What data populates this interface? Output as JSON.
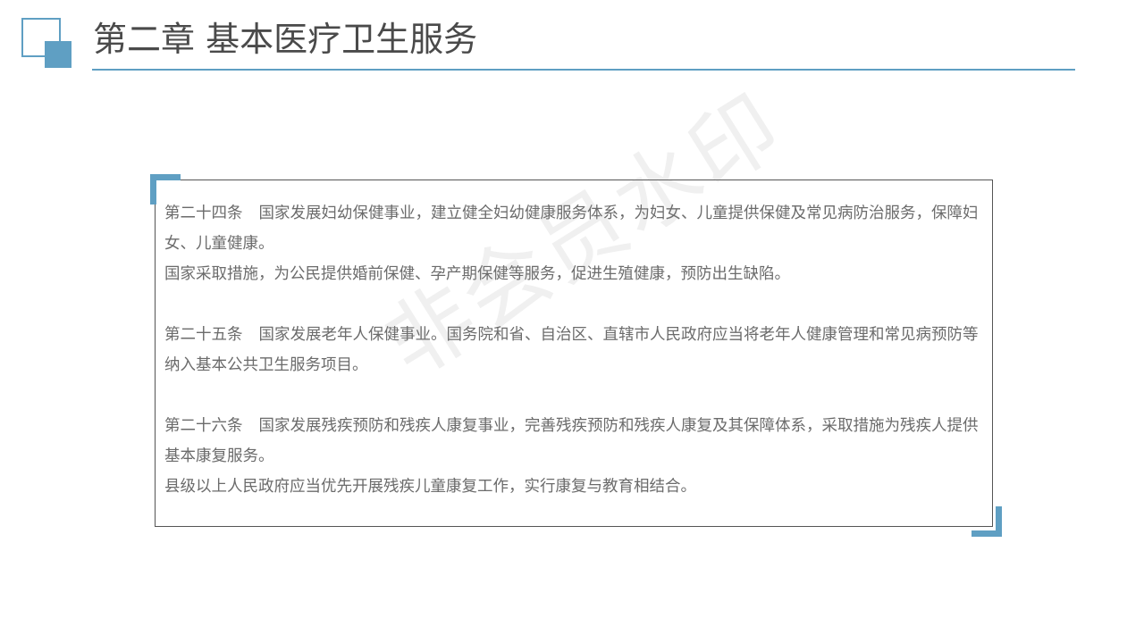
{
  "header": {
    "title": "第二章 基本医疗卫生服务"
  },
  "articles": [
    {
      "number": "第二十四条",
      "paragraphs": [
        "国家发展妇幼保健事业，建立健全妇幼健康服务体系，为妇女、儿童提供保健及常见病防治服务，保障妇女、儿童健康。",
        "国家采取措施，为公民提供婚前保健、孕产期保健等服务，促进生殖健康，预防出生缺陷。"
      ]
    },
    {
      "number": "第二十五条",
      "paragraphs": [
        "国家发展老年人保健事业。国务院和省、自治区、直辖市人民政府应当将老年人健康管理和常见病预防等纳入基本公共卫生服务项目。"
      ]
    },
    {
      "number": "第二十六条",
      "paragraphs": [
        "国家发展残疾预防和残疾人康复事业，完善残疾预防和残疾人康复及其保障体系，采取措施为残疾人提供基本康复服务。",
        "县级以上人民政府应当优先开展残疾儿童康复工作，实行康复与教育相结合。"
      ]
    }
  ],
  "watermark": {
    "text": "非会员水印"
  },
  "colors": {
    "accent": "#5f9fc3",
    "title_text": "#4a4a4a",
    "body_text": "#6b6b6b",
    "box_border": "#555555"
  }
}
